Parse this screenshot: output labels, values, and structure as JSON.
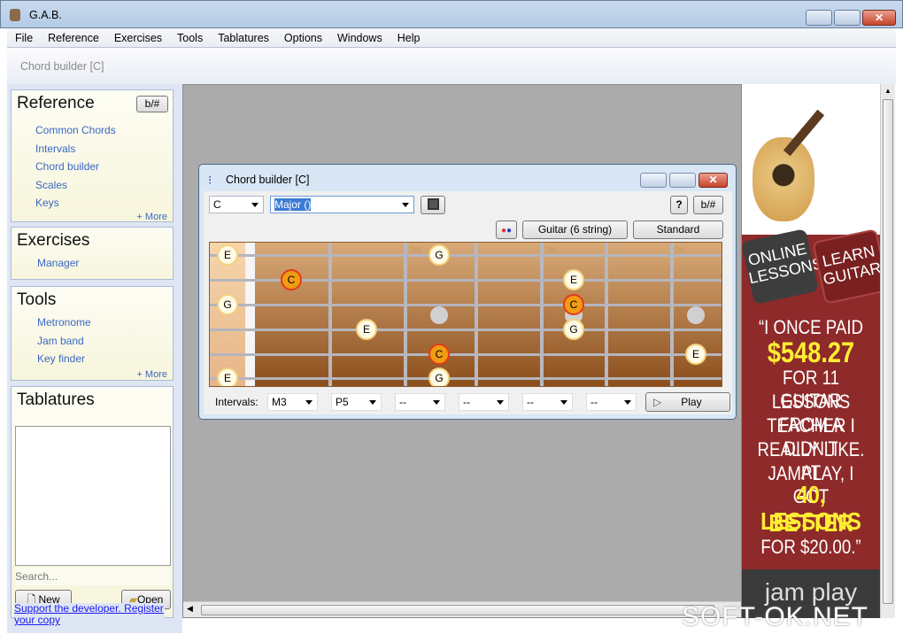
{
  "window": {
    "title": "G.A.B."
  },
  "menu": [
    "File",
    "Reference",
    "Exercises",
    "Tools",
    "Tablatures",
    "Options",
    "Windows",
    "Help"
  ],
  "toolstrip": {
    "active_window": "Chord builder [C]"
  },
  "sidebar": {
    "reference": {
      "title": "Reference",
      "toggle": "b/#",
      "items": [
        "Common Chords",
        "Intervals",
        "Chord builder",
        "Scales",
        "Keys"
      ],
      "more": "+ More"
    },
    "exercises": {
      "title": "Exercises",
      "items": [
        "Manager"
      ]
    },
    "tools": {
      "title": "Tools",
      "items": [
        "Metronome",
        "Jam band",
        "Key finder"
      ],
      "more": "+ More"
    },
    "tablatures": {
      "title": "Tablatures",
      "search_placeholder": "Search...",
      "new": "New",
      "open": "Open"
    },
    "register_link": "Support the developer. Register your copy"
  },
  "chord_builder": {
    "title": "Chord builder [C]",
    "root": "C",
    "chord_type": "Major ()",
    "help": "?",
    "toggle": "b/#",
    "instrument": "Guitar (6 string)",
    "tuning": "Standard",
    "fret_markers": [
      "3rd",
      "5th",
      "7th"
    ],
    "notes": [
      {
        "string": 1,
        "fret": 0,
        "note": "E"
      },
      {
        "string": 2,
        "fret": 1,
        "note": "C",
        "root": true
      },
      {
        "string": 3,
        "fret": 0,
        "note": "G"
      },
      {
        "string": 4,
        "fret": 2,
        "note": "E"
      },
      {
        "string": 1,
        "fret": 3,
        "note": "G"
      },
      {
        "string": 5,
        "fret": 3,
        "note": "C",
        "root": true
      },
      {
        "string": 6,
        "fret": 3,
        "note": "G"
      },
      {
        "string": 2,
        "fret": 5,
        "note": "E"
      },
      {
        "string": 3,
        "fret": 5,
        "note": "C",
        "root": true
      },
      {
        "string": 4,
        "fret": 5,
        "note": "G"
      },
      {
        "string": 5,
        "fret": 7,
        "note": "E"
      },
      {
        "string": 6,
        "fret": 0,
        "note": "E"
      }
    ],
    "intervals_label": "Intervals:",
    "intervals": [
      "M3",
      "P5",
      "--",
      "--",
      "--",
      "--"
    ],
    "play": "Play"
  },
  "ad": {
    "tab1": "ONLINE LESSONS",
    "tab2": "LEARN GUITAR",
    "lines": [
      "“I ONCE PAID",
      "$548.27",
      "FOR 11 GUITAR",
      "LESSONS FROM A",
      "TEACHER I DIDN’T",
      "REALLY LIKE.  AT",
      "JAMPLAY, I GOT",
      "40, BETTER",
      "LESSONS",
      "FOR $20.00.”"
    ],
    "logo": "jam play"
  },
  "watermark": "SOFT-OK.NET"
}
